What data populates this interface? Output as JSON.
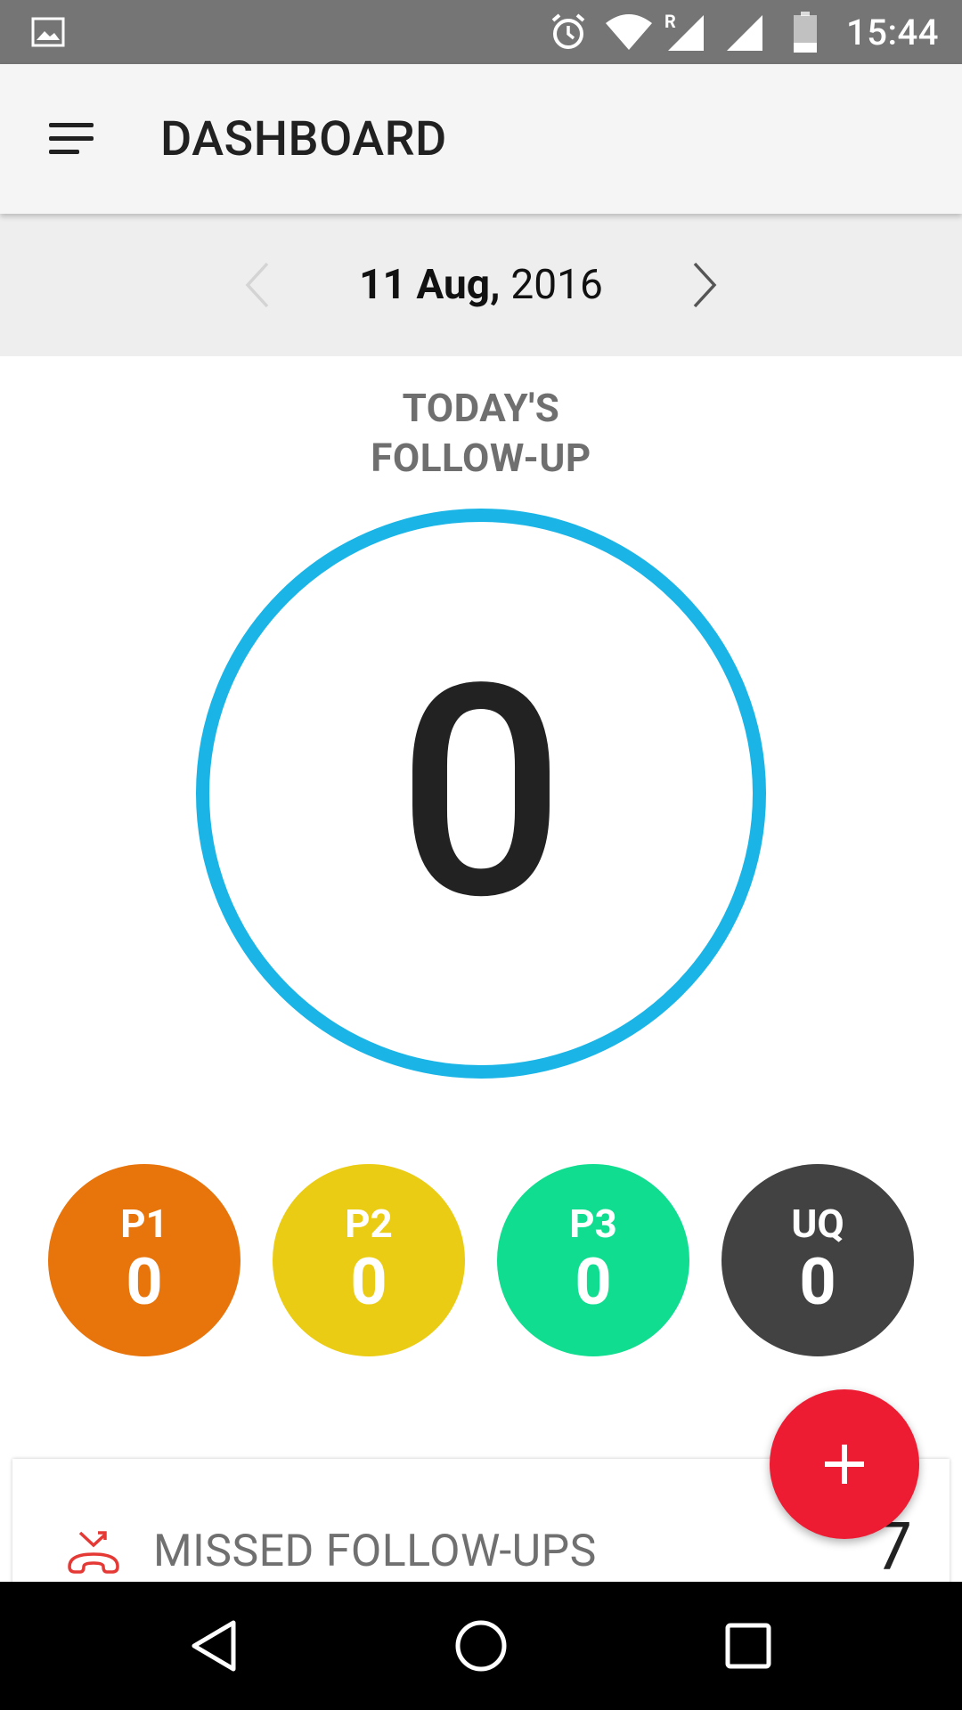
{
  "status_bar": {
    "time": "15:44",
    "icons": [
      "gallery-icon",
      "alarm-icon",
      "wifi-icon",
      "signal-icon",
      "battery-icon"
    ],
    "roaming": "R"
  },
  "app_bar": {
    "title": "DASHBOARD",
    "menu_icon": "hamburger-menu-icon"
  },
  "date_nav": {
    "day_month": "11 Aug,",
    "year": "2016",
    "prev_icon": "chevron-left-icon",
    "next_icon": "chevron-right-icon"
  },
  "followup": {
    "title_line1": "TODAY'S",
    "title_line2": "FOLLOW-UP",
    "count": "0",
    "ring_color": "#1ab5e6"
  },
  "priorities": [
    {
      "label": "P1",
      "count": "0",
      "color": "#e8740c"
    },
    {
      "label": "P2",
      "count": "0",
      "color": "#ebcc14"
    },
    {
      "label": "P3",
      "count": "0",
      "color": "#10dd8f"
    },
    {
      "label": "UQ",
      "count": "0",
      "color": "#424242"
    }
  ],
  "missed": {
    "label": "MISSED FOLLOW-UPS",
    "count": "7",
    "icon": "missed-call-icon"
  },
  "fab": {
    "icon": "plus-icon",
    "color": "#ee1c33"
  },
  "nav_bar": {
    "back_icon": "back-triangle-icon",
    "home_icon": "home-circle-icon",
    "recent_icon": "recents-square-icon"
  }
}
